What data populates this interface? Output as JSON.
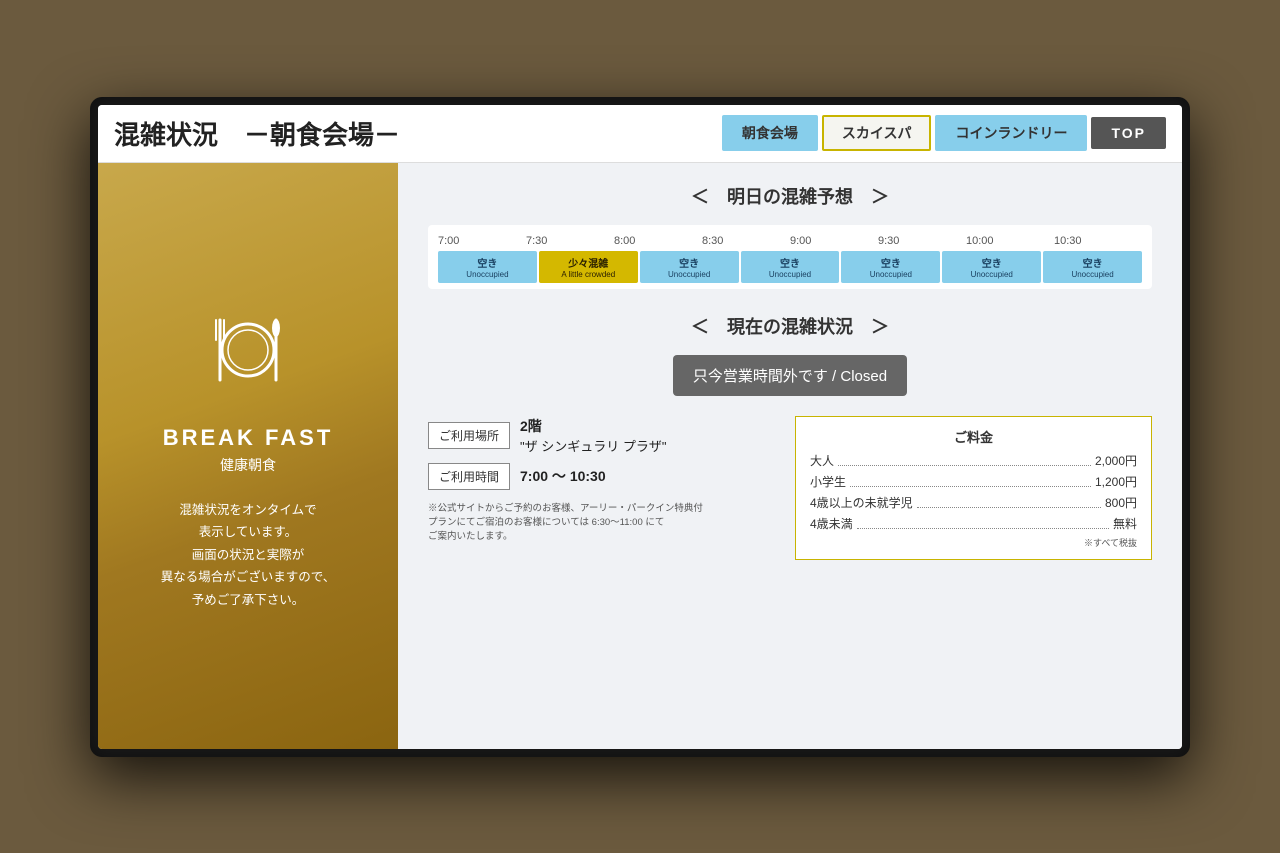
{
  "header": {
    "title": "混雑状況　－朝食会場－",
    "nav": {
      "tab_breakfast": "朝食会場",
      "tab_skylounge": "スカイスパ",
      "tab_laundry": "コインランドリー",
      "tab_top": "TOP"
    }
  },
  "left_panel": {
    "title_en": "BREAK FAST",
    "title_jp": "健康朝食",
    "description": "混雑状況をオンタイムで\n表示しています。\n画面の状況と実際が\n異なる場合がございますので、\n予めご了承下さい。"
  },
  "tomorrow_section": {
    "title": "＜　明日の混雑予想　＞",
    "time_labels": [
      "7:00",
      "7:30",
      "8:00",
      "8:30",
      "9:00",
      "9:30",
      "10:00",
      "10:30"
    ],
    "bars": [
      {
        "jp": "空き",
        "en": "Unoccupied",
        "type": "unoccupied"
      },
      {
        "jp": "少々混雑",
        "en": "A little crowded",
        "type": "crowded"
      },
      {
        "jp": "空き",
        "en": "Unoccupied",
        "type": "unoccupied"
      },
      {
        "jp": "空き",
        "en": "Unoccupied",
        "type": "unoccupied"
      },
      {
        "jp": "空き",
        "en": "Unoccupied",
        "type": "unoccupied"
      },
      {
        "jp": "空き",
        "en": "Unoccupied",
        "type": "unoccupied"
      },
      {
        "jp": "空き",
        "en": "Unoccupied",
        "type": "unoccupied"
      }
    ]
  },
  "current_section": {
    "title": "＜　現在の混雑状況　＞",
    "closed_text": "只今営業時間外です / Closed"
  },
  "info_section": {
    "location_label": "ご利用場所",
    "location_value": "2階",
    "location_sub": "\"ザ シンギュラリ プラザ\"",
    "hours_label": "ご利用時間",
    "hours_value": "7:00 〜 10:30",
    "note": "※公式サイトからご予約のお客様、アーリー・パークイン特典付\nプランにてご宿泊のお客様については 6:30〜11:00 にて\nご案内いたします。",
    "pricing_header": "ご料金",
    "prices": [
      {
        "label": "大人",
        "price": "2,000円"
      },
      {
        "label": "小学生",
        "price": "1,200円"
      },
      {
        "label": "4歳以上の未就学児",
        "price": "800円"
      },
      {
        "label": "4歳未満",
        "price": "無料"
      }
    ],
    "pricing_note": "※すべて税抜"
  }
}
